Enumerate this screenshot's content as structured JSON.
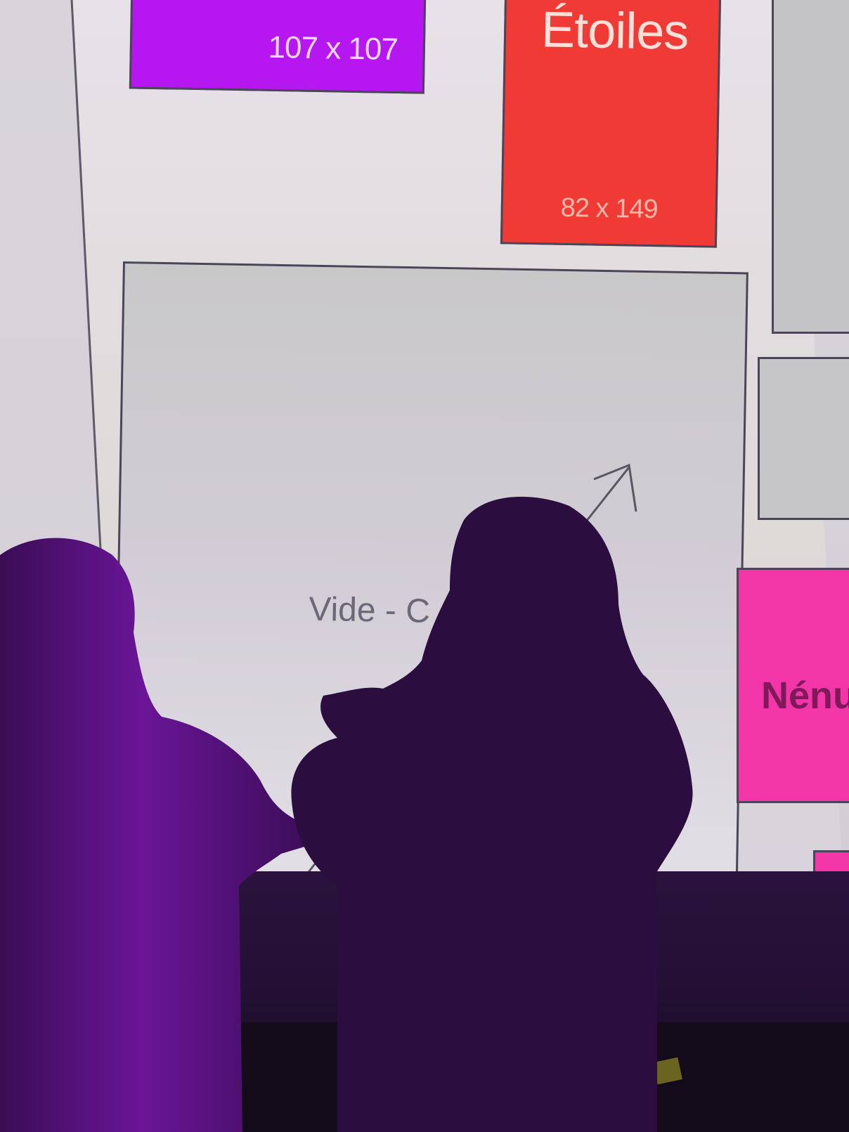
{
  "tiles": {
    "purple": {
      "dims": "107 x 107"
    },
    "red": {
      "title": "Étoiles",
      "dims": "82 x 149"
    },
    "center": {
      "label": "Vide - C"
    },
    "pink": {
      "title": "Nénu"
    }
  },
  "colors": {
    "purple_tile": "#b616f0",
    "red_tile": "#f03a36",
    "pink_tile": "#f236a8",
    "gray_tile": "#c4c4c6",
    "silhouette": "#2b0d3f",
    "floor": "#241036"
  }
}
